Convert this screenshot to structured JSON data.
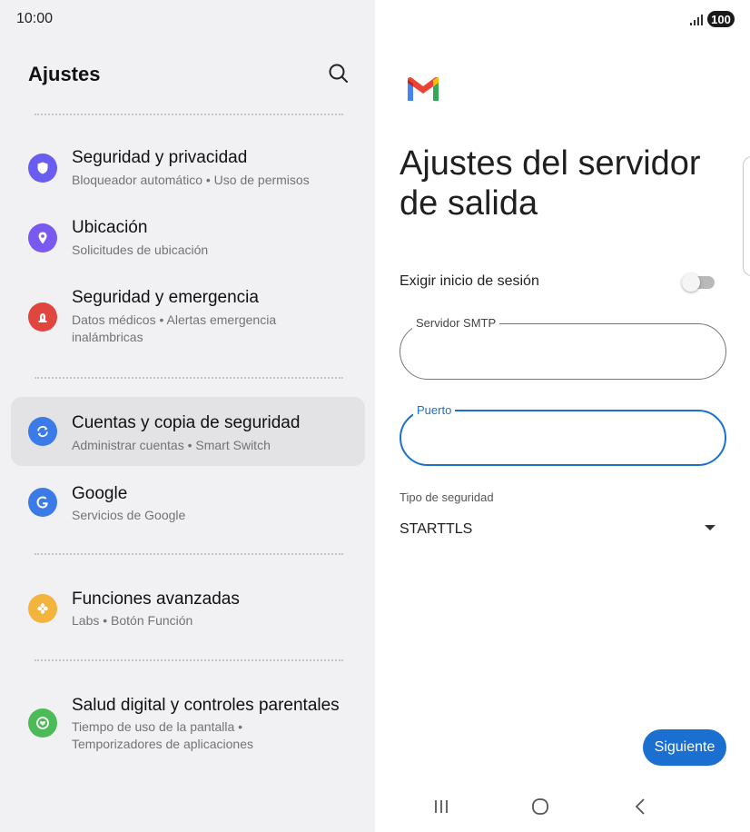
{
  "status_bar": {
    "time": "10:00",
    "battery": "100",
    "signal_icon": "signal-icon"
  },
  "settings": {
    "title": "Ajustes",
    "search_icon": "search-icon",
    "items": [
      {
        "title": "Seguridad y privacidad",
        "subtitle": "Bloqueador automático • Uso de permisos",
        "icon": "shield-icon",
        "color": "#6a5cf0"
      },
      {
        "title": "Ubicación",
        "subtitle": "Solicitudes de ubicación",
        "icon": "location-pin-icon",
        "color": "#7a59f0"
      },
      {
        "title": "Seguridad y emergencia",
        "subtitle_line1": "Datos médicos • Alertas emergencia",
        "subtitle_line2": "inalámbricas",
        "icon": "emergency-icon",
        "color": "#e0463e"
      },
      {
        "title": "Cuentas y copia de seguridad",
        "subtitle": "Administrar cuentas • Smart Switch",
        "icon": "sync-icon",
        "color": "#3b7be8",
        "selected": true
      },
      {
        "title": "Google",
        "subtitle": "Servicios de Google",
        "icon": "google-icon",
        "color": "#3b7be8"
      },
      {
        "title": "Funciones avanzadas",
        "subtitle": "Labs • Botón Función",
        "icon": "gear-icon",
        "color": "#f3b33d"
      },
      {
        "title": "Salud digital y controles parentales",
        "subtitle_line1": "Tiempo de uso de la pantalla •",
        "subtitle_line2": "Temporizadores de aplicaciones",
        "icon": "digital-wellbeing-icon",
        "color": "#4cbb57"
      }
    ]
  },
  "gmail": {
    "logo_icon": "gmail-logo-icon",
    "title": "Ajustes del servidor de salida",
    "require_signin_label": "Exigir inicio de sesión",
    "require_signin_on": false,
    "smtp_label": "Servidor SMTP",
    "smtp_value": "",
    "port_label": "Puerto",
    "port_value": "",
    "security_type_label": "Tipo de seguridad",
    "security_type_value": "STARTTLS",
    "next_button": "Siguiente",
    "accent_color": "#1a6fd1"
  },
  "nav_bar": {
    "recents_icon": "recents-icon",
    "home_icon": "home-icon",
    "back_icon": "back-icon"
  }
}
